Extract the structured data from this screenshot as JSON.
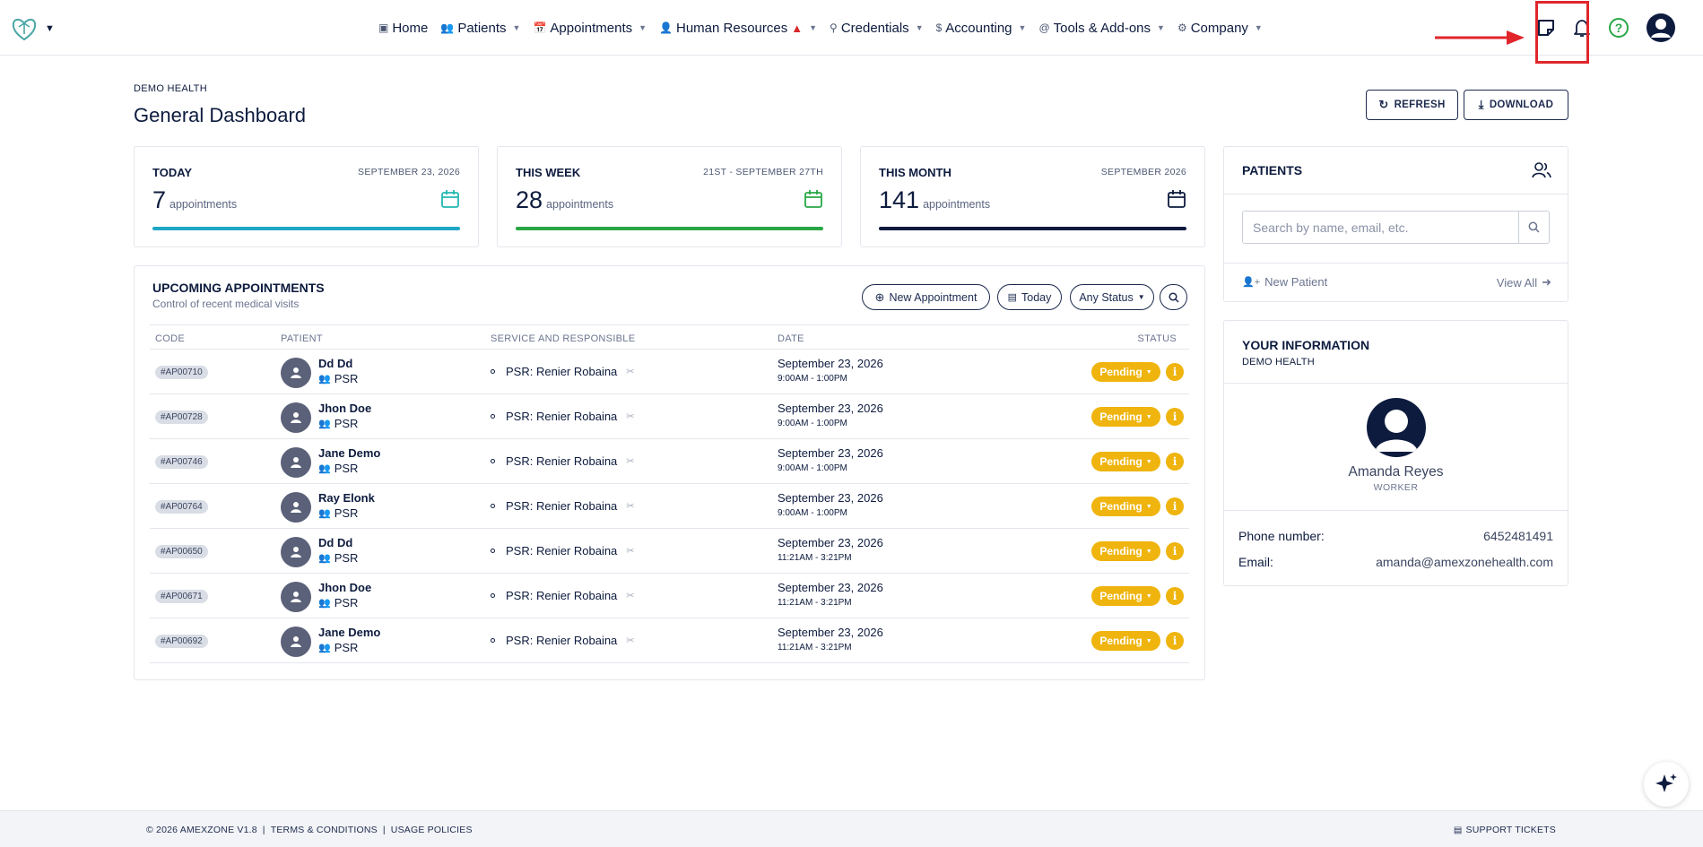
{
  "nav": {
    "items": [
      {
        "label": "Home",
        "icon": "monitor-icon",
        "caret": false
      },
      {
        "label": "Patients",
        "icon": "users-icon",
        "caret": true
      },
      {
        "label": "Appointments",
        "icon": "calendar-icon",
        "caret": true
      },
      {
        "label": "Human Resources",
        "icon": "user-plus-icon",
        "caret": true,
        "warning": true
      },
      {
        "label": "Credentials",
        "icon": "key-icon",
        "caret": true
      },
      {
        "label": "Accounting",
        "icon": "dollar-icon",
        "caret": true
      },
      {
        "label": "Tools & Add-ons",
        "icon": "at-icon",
        "caret": true
      },
      {
        "label": "Company",
        "icon": "gear-icon",
        "caret": true
      }
    ]
  },
  "header": {
    "org": "DEMO HEALTH",
    "title": "General Dashboard",
    "refresh_label": "REFRESH",
    "download_label": "DOWNLOAD"
  },
  "stats": [
    {
      "title": "TODAY",
      "date": "SEPTEMBER 23, 2026",
      "value": "7",
      "unit": "appointments",
      "bar_color": "#1ea7c5",
      "icon_color": "#22b7b0"
    },
    {
      "title": "THIS WEEK",
      "date": "21ST - SEPTEMBER 27TH",
      "value": "28",
      "unit": "appointments",
      "bar_color": "#28a745",
      "icon_color": "#28a745"
    },
    {
      "title": "THIS MONTH",
      "date": "SEPTEMBER 2026",
      "value": "141",
      "unit": "appointments",
      "bar_color": "#0d1b3e",
      "icon_color": "#0d1b3e"
    }
  ],
  "appointments": {
    "title": "UPCOMING APPOINTMENTS",
    "subtitle": "Control of recent medical visits",
    "new_label": "New Appointment",
    "today_label": "Today",
    "status_filter": "Any Status",
    "columns": {
      "code": "CODE",
      "patient": "PATIENT",
      "service": "SERVICE AND RESPONSIBLE",
      "date": "DATE",
      "status": "STATUS"
    },
    "rows": [
      {
        "code": "#AP00710",
        "name": "Dd Dd",
        "role": "PSR",
        "service": "PSR: Renier Robaina",
        "date": "September 23, 2026",
        "time": "9:00AM - 1:00PM",
        "status": "Pending"
      },
      {
        "code": "#AP00728",
        "name": "Jhon Doe",
        "role": "PSR",
        "service": "PSR: Renier Robaina",
        "date": "September 23, 2026",
        "time": "9:00AM - 1:00PM",
        "status": "Pending"
      },
      {
        "code": "#AP00746",
        "name": "Jane Demo",
        "role": "PSR",
        "service": "PSR: Renier Robaina",
        "date": "September 23, 2026",
        "time": "9:00AM - 1:00PM",
        "status": "Pending"
      },
      {
        "code": "#AP00764",
        "name": "Ray Elonk",
        "role": "PSR",
        "service": "PSR: Renier Robaina",
        "date": "September 23, 2026",
        "time": "9:00AM - 1:00PM",
        "status": "Pending"
      },
      {
        "code": "#AP00650",
        "name": "Dd Dd",
        "role": "PSR",
        "service": "PSR: Renier Robaina",
        "date": "September 23, 2026",
        "time": "11:21AM - 3:21PM",
        "status": "Pending"
      },
      {
        "code": "#AP00671",
        "name": "Jhon Doe",
        "role": "PSR",
        "service": "PSR: Renier Robaina",
        "date": "September 23, 2026",
        "time": "11:21AM - 3:21PM",
        "status": "Pending"
      },
      {
        "code": "#AP00692",
        "name": "Jane Demo",
        "role": "PSR",
        "service": "PSR: Renier Robaina",
        "date": "September 23, 2026",
        "time": "11:21AM - 3:21PM",
        "status": "Pending"
      }
    ]
  },
  "patients": {
    "title": "PATIENTS",
    "search_placeholder": "Search by name, email, etc.",
    "new_label": "New Patient",
    "view_all_label": "View All"
  },
  "your_info": {
    "title": "YOUR INFORMATION",
    "org": "DEMO HEALTH",
    "name": "Amanda Reyes",
    "role": "WORKER",
    "phone_label": "Phone number:",
    "phone": "6452481491",
    "email_label": "Email:",
    "email": "amanda@amexzonehealth.com"
  },
  "footer": {
    "copyright": "© 2026 AMEXZONE V1.8",
    "terms": "TERMS & CONDITIONS",
    "usage": "USAGE POLICIES",
    "support": "SUPPORT TICKETS"
  },
  "colors": {
    "brand": "#0d1b3e",
    "pending": "#efb40d",
    "annotation": "#e0262b"
  }
}
